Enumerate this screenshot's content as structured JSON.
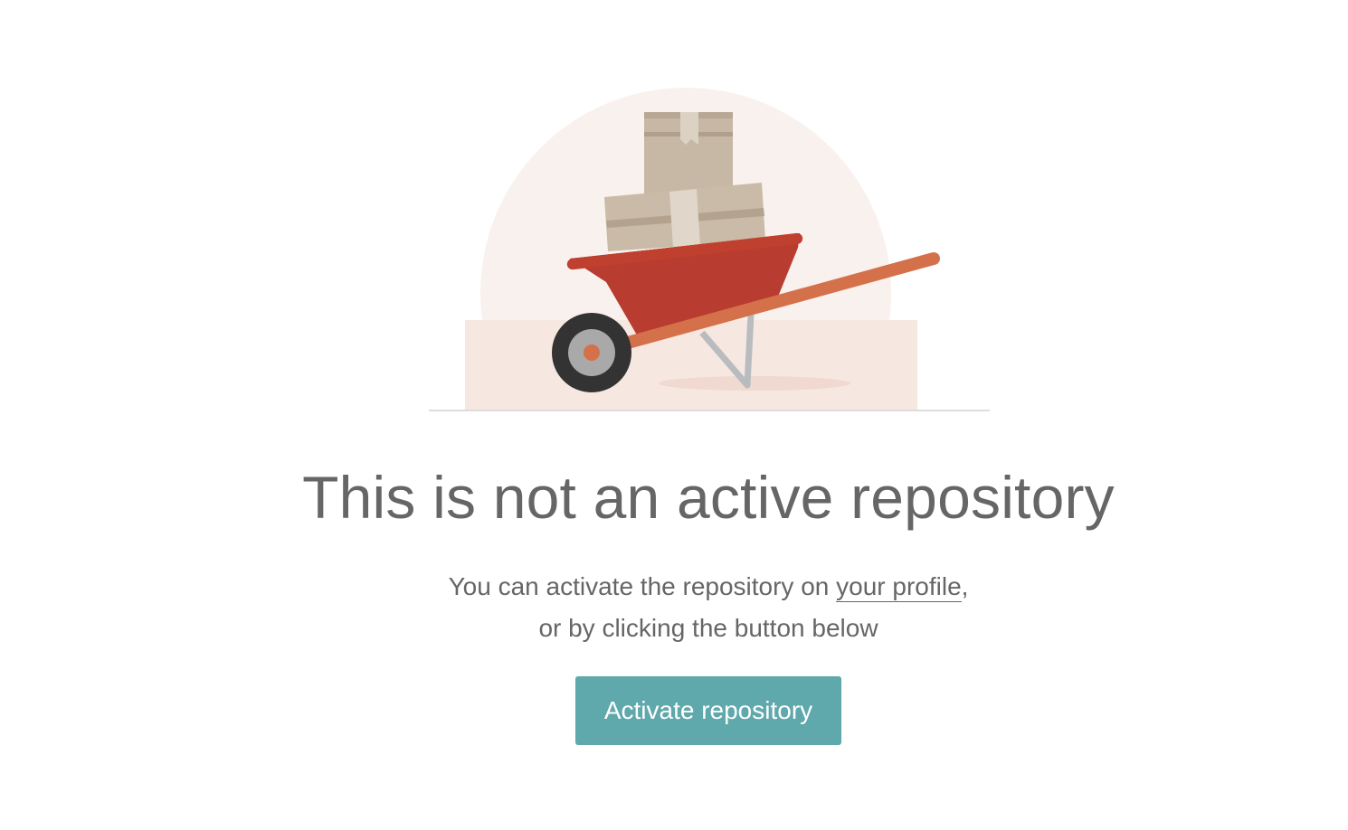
{
  "empty_state": {
    "illustration_icon": "wheelbarrow-with-boxes",
    "title": "This is not an active repository",
    "message_before_link": "You can activate the repository on ",
    "profile_link_label": "your profile",
    "message_after_link": ",",
    "message_line_two": "or by clicking the button below",
    "activate_button_label": "Activate repository"
  },
  "colors": {
    "button_background": "#5fa8ac",
    "text": "#666666",
    "wheelbarrow_tray": "#c0392b",
    "wheelbarrow_handle": "#d4714a",
    "circle_background": "#f9f1ee"
  }
}
